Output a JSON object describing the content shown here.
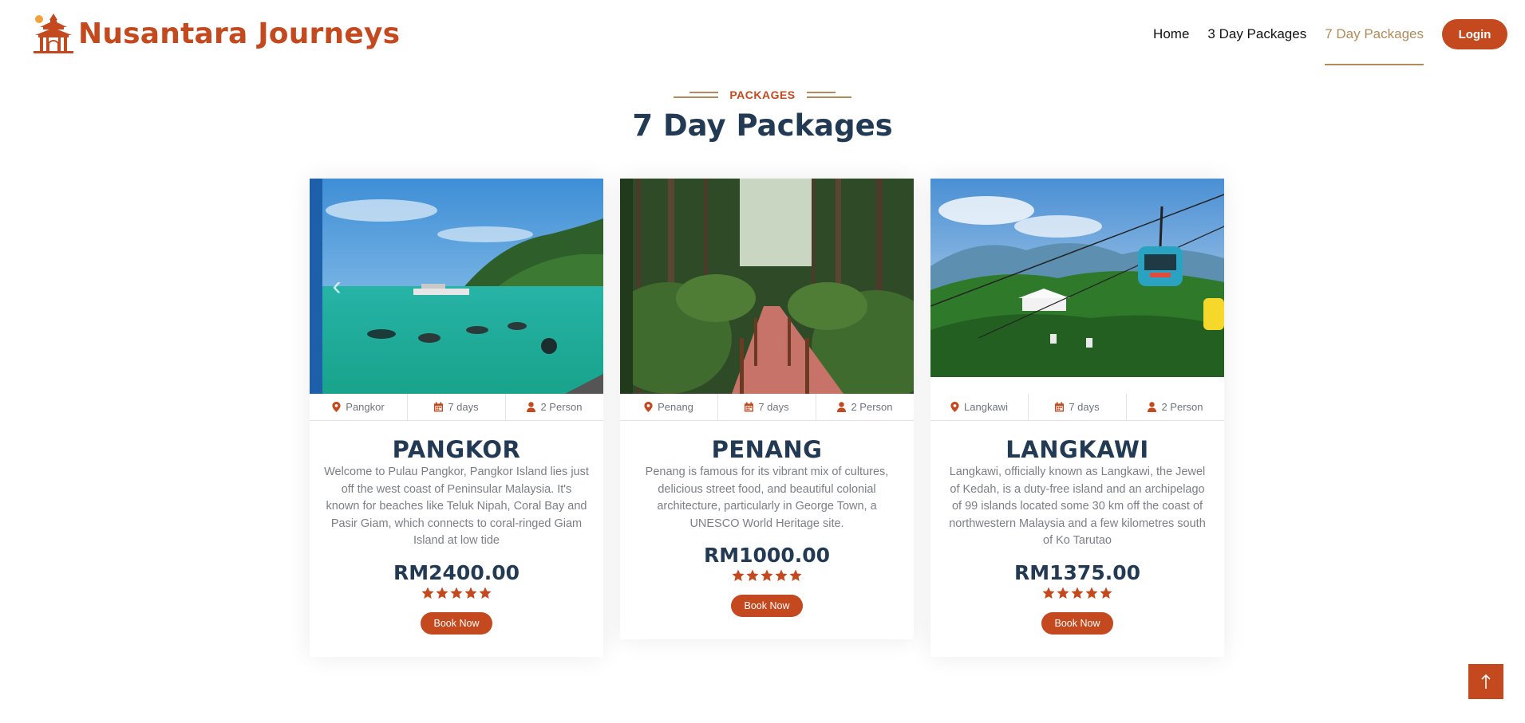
{
  "brand": {
    "name": "Nusantara Journeys",
    "logo_icon": "pagoda-logo-icon"
  },
  "nav": {
    "links": [
      {
        "label": "Home",
        "active": false
      },
      {
        "label": "3 Day Packages",
        "active": false
      },
      {
        "label": "7 Day Packages",
        "active": true
      }
    ],
    "login_label": "Login"
  },
  "section": {
    "eyebrow": "PACKAGES",
    "title": "7 Day Packages"
  },
  "packages": [
    {
      "location": "Pangkor",
      "duration": "7 days",
      "persons": "2 Person",
      "title": "PANGKOR",
      "description": "Welcome to Pulau Pangkor, Pangkor Island lies just off the west coast of Peninsular Malaysia. It's known for beaches like Teluk Nipah, Coral Bay and Pasir Giam, which connects to coral-ringed Giam Island at low tide",
      "price": "RM2400.00",
      "rating": 5,
      "book_label": "Book Now",
      "image_scene": "beach-snorkelers"
    },
    {
      "location": "Penang",
      "duration": "7 days",
      "persons": "2 Person",
      "title": "PENANG",
      "description": "Penang is famous for its vibrant mix of cultures, delicious street food, and beautiful colonial architecture, particularly in George Town, a UNESCO World Heritage site.",
      "price": "RM1000.00",
      "rating": 5,
      "book_label": "Book Now",
      "image_scene": "forest-boardwalk"
    },
    {
      "location": "Langkawi",
      "duration": "7 days",
      "persons": "2 Person",
      "title": "LANGKAWI",
      "description": "Langkawi, officially known as Langkawi, the Jewel of Kedah, is a duty-free island and an archipelago of 99 islands located some 30 km off the coast of northwestern Malaysia and a few kilometres south of Ko Tarutao",
      "price": "RM1375.00",
      "rating": 5,
      "book_label": "Book Now",
      "image_scene": "cable-car-mountains"
    }
  ],
  "back_to_top_icon": "arrow-up-icon",
  "colors": {
    "accent": "#c4491e",
    "active_nav": "#b38a5a",
    "heading": "#233a54",
    "muted_text": "#7a7f86"
  }
}
